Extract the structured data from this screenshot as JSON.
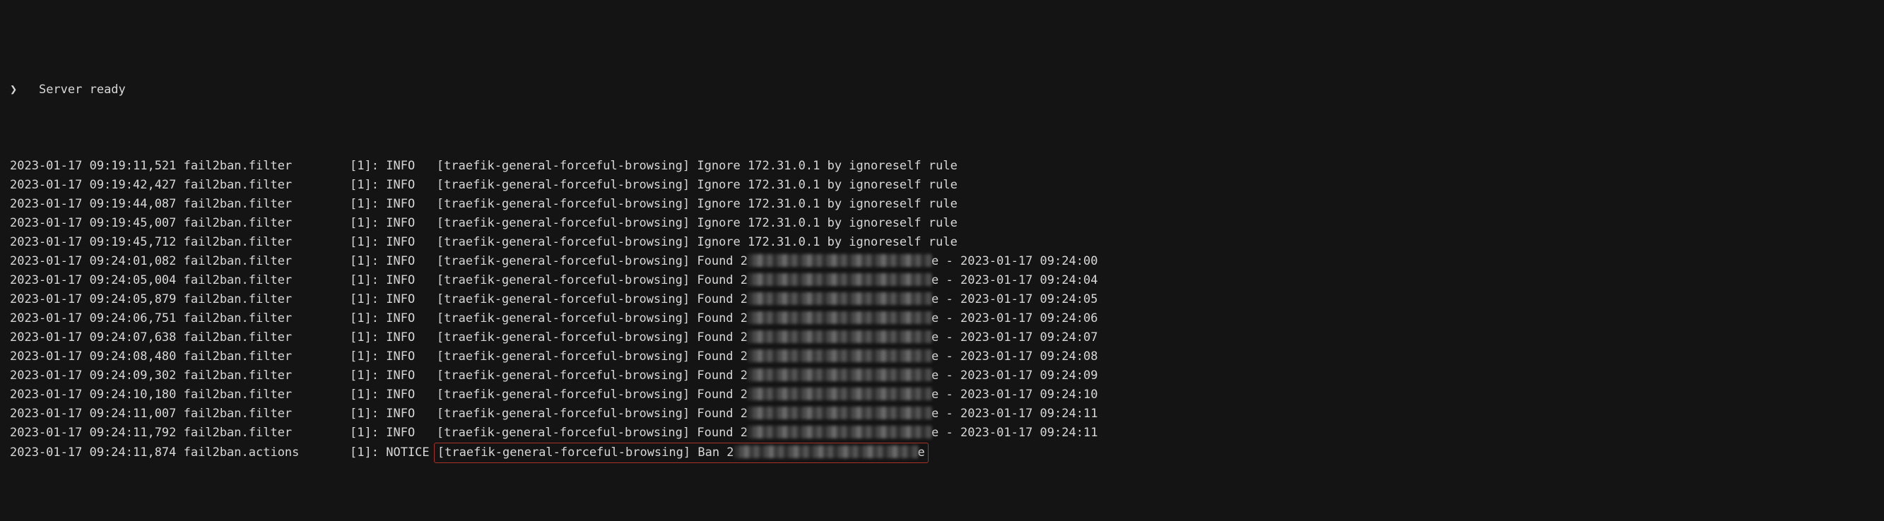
{
  "header": {
    "prompt": "❯",
    "text": "   Server ready"
  },
  "jail": "[traefik-general-forceful-browsing]",
  "thread": "[1]:",
  "levels": {
    "info": "INFO  ",
    "notice": "NOTICE"
  },
  "ignore_ip": "172.31.0.1",
  "ignore_rule": "ignoreself",
  "rows": [
    {
      "ts": "2023-01-17 09:19:11,521",
      "src": "fail2ban.filter ",
      "lvl": "info",
      "kind": "ignore"
    },
    {
      "ts": "2023-01-17 09:19:42,427",
      "src": "fail2ban.filter ",
      "lvl": "info",
      "kind": "ignore"
    },
    {
      "ts": "2023-01-17 09:19:44,087",
      "src": "fail2ban.filter ",
      "lvl": "info",
      "kind": "ignore"
    },
    {
      "ts": "2023-01-17 09:19:45,007",
      "src": "fail2ban.filter ",
      "lvl": "info",
      "kind": "ignore"
    },
    {
      "ts": "2023-01-17 09:19:45,712",
      "src": "fail2ban.filter ",
      "lvl": "info",
      "kind": "ignore"
    },
    {
      "ts": "2023-01-17 09:24:01,082",
      "src": "fail2ban.filter ",
      "lvl": "info",
      "kind": "found",
      "found_ts": "2023-01-17 09:24:00"
    },
    {
      "ts": "2023-01-17 09:24:05,004",
      "src": "fail2ban.filter ",
      "lvl": "info",
      "kind": "found",
      "found_ts": "2023-01-17 09:24:04"
    },
    {
      "ts": "2023-01-17 09:24:05,879",
      "src": "fail2ban.filter ",
      "lvl": "info",
      "kind": "found",
      "found_ts": "2023-01-17 09:24:05"
    },
    {
      "ts": "2023-01-17 09:24:06,751",
      "src": "fail2ban.filter ",
      "lvl": "info",
      "kind": "found",
      "found_ts": "2023-01-17 09:24:06"
    },
    {
      "ts": "2023-01-17 09:24:07,638",
      "src": "fail2ban.filter ",
      "lvl": "info",
      "kind": "found",
      "found_ts": "2023-01-17 09:24:07"
    },
    {
      "ts": "2023-01-17 09:24:08,480",
      "src": "fail2ban.filter ",
      "lvl": "info",
      "kind": "found",
      "found_ts": "2023-01-17 09:24:08"
    },
    {
      "ts": "2023-01-17 09:24:09,302",
      "src": "fail2ban.filter ",
      "lvl": "info",
      "kind": "found",
      "found_ts": "2023-01-17 09:24:09"
    },
    {
      "ts": "2023-01-17 09:24:10,180",
      "src": "fail2ban.filter ",
      "lvl": "info",
      "kind": "found",
      "found_ts": "2023-01-17 09:24:10"
    },
    {
      "ts": "2023-01-17 09:24:11,007",
      "src": "fail2ban.filter ",
      "lvl": "info",
      "kind": "found",
      "found_ts": "2023-01-17 09:24:11"
    },
    {
      "ts": "2023-01-17 09:24:11,792",
      "src": "fail2ban.filter ",
      "lvl": "info",
      "kind": "found",
      "found_ts": "2023-01-17 09:24:11"
    },
    {
      "ts": "2023-01-17 09:24:11,874",
      "src": "fail2ban.actions",
      "lvl": "notice",
      "kind": "ban",
      "highlight": true
    }
  ],
  "words": {
    "ignore": "Ignore",
    "found": "Found",
    "ban": "Ban",
    "by": "by",
    "rule": "rule",
    "two": "2",
    "e": "e",
    "dash": " - "
  }
}
